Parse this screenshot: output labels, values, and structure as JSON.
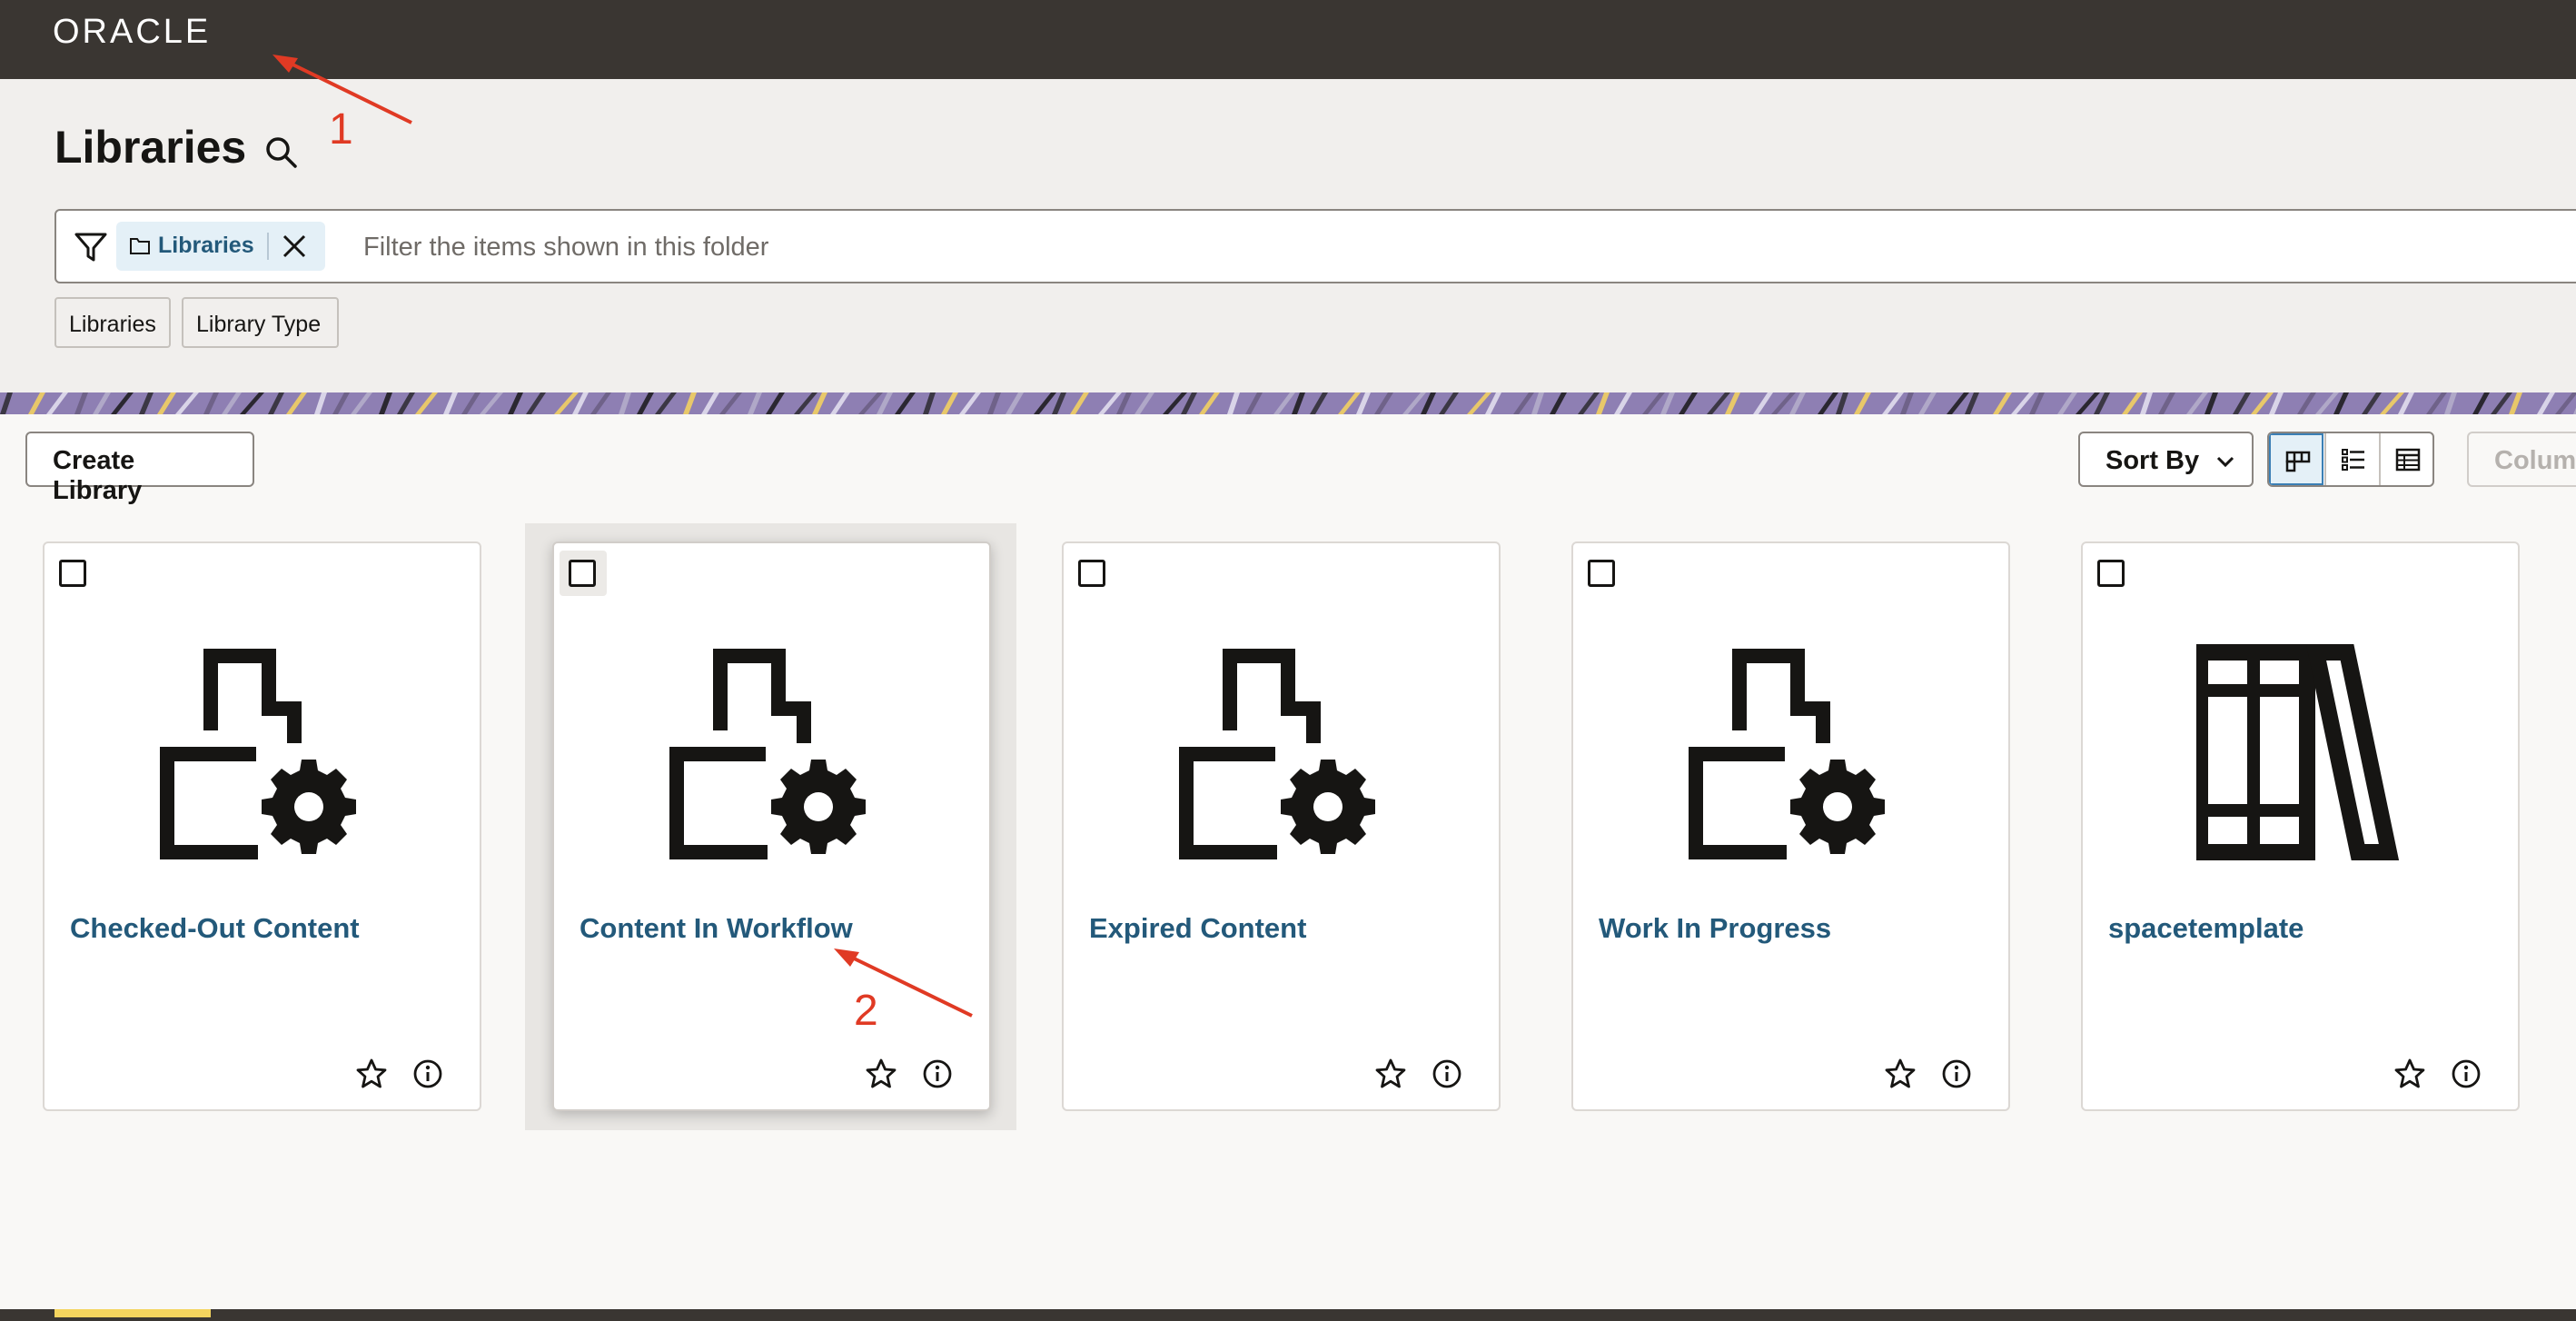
{
  "header": {
    "logo": "ORACLE"
  },
  "page": {
    "title": "Libraries"
  },
  "filter": {
    "chip_label": "Libraries",
    "placeholder": "Filter the items shown in this folder"
  },
  "quick_filters": [
    "Libraries",
    "Library Type"
  ],
  "toolbar": {
    "create_label": "Create Library",
    "sort_label": "Sort By",
    "columns_label": "Colum"
  },
  "cards": [
    {
      "title": "Checked-Out Content",
      "icon": "folder-gear-icon"
    },
    {
      "title": "Content In Workflow",
      "icon": "folder-gear-icon"
    },
    {
      "title": "Expired Content",
      "icon": "folder-gear-icon"
    },
    {
      "title": "Work In Progress",
      "icon": "folder-gear-icon"
    },
    {
      "title": "spacetemplate",
      "icon": "library-books-icon"
    }
  ],
  "annotations": [
    "1",
    "2"
  ],
  "colors": {
    "accent": "#23597a",
    "header": "#3a3632",
    "annotation": "#e03a24"
  }
}
